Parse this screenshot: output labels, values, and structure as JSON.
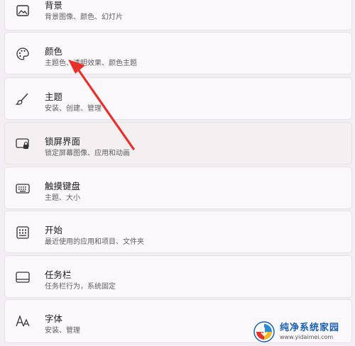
{
  "settings": {
    "items": [
      {
        "icon": "image-icon",
        "title": "背景",
        "subtitle": "背景图像、颜色、幻灯片"
      },
      {
        "icon": "palette-icon",
        "title": "颜色",
        "subtitle": "主题色、透明效果、颜色主题"
      },
      {
        "icon": "brush-icon",
        "title": "主题",
        "subtitle": "安装、创建、管理"
      },
      {
        "icon": "lock-screen-icon",
        "title": "锁屏界面",
        "subtitle": "锁定屏幕图像、应用和动画"
      },
      {
        "icon": "keyboard-icon",
        "title": "触摸键盘",
        "subtitle": "主题、大小"
      },
      {
        "icon": "start-icon",
        "title": "开始",
        "subtitle": "最近使用的应用和项目、文件夹"
      },
      {
        "icon": "taskbar-icon",
        "title": "任务栏",
        "subtitle": "任务栏行为，系统固定"
      },
      {
        "icon": "font-icon",
        "title": "字体",
        "subtitle": "安装、管理"
      }
    ]
  },
  "annotation": {
    "color": "#e8302a"
  },
  "watermark": {
    "name": "纯净系统家园",
    "url": "www.yidaimei.com"
  }
}
